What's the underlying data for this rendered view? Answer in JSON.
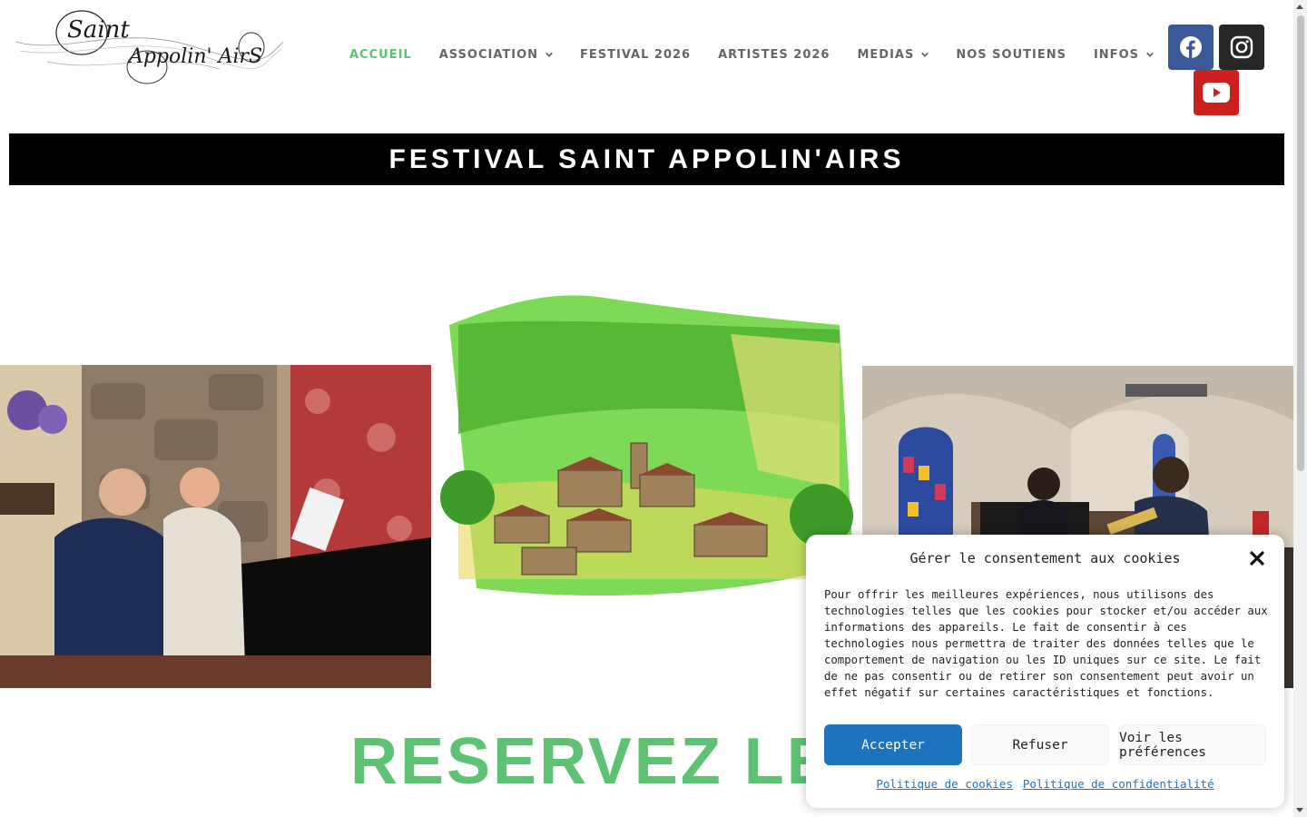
{
  "logo": {
    "line1": "Saint",
    "line2": "Appolin' AirS"
  },
  "nav": {
    "items": [
      {
        "label": "ACCUEIL",
        "active": true,
        "dropdown": false
      },
      {
        "label": "ASSOCIATION",
        "active": false,
        "dropdown": true
      },
      {
        "label": "FESTIVAL 2026",
        "active": false,
        "dropdown": false
      },
      {
        "label": "ARTISTES 2026",
        "active": false,
        "dropdown": false
      },
      {
        "label": "MEDIAS",
        "active": false,
        "dropdown": true
      },
      {
        "label": "NOS SOUTIENS",
        "active": false,
        "dropdown": false
      },
      {
        "label": "INFOS",
        "active": false,
        "dropdown": true
      }
    ]
  },
  "social": [
    {
      "name": "facebook-icon",
      "color": "#3b5998"
    },
    {
      "name": "instagram-icon",
      "color": "#262626"
    },
    {
      "name": "youtube-icon",
      "color": "#cd201f"
    }
  ],
  "banner": {
    "title": "FESTIVAL SAINT APPOLIN'AIRS"
  },
  "main": {
    "reserve_heading": "RESERVEZ LES 1"
  },
  "cookie_dialog": {
    "title": "Gérer le consentement aux cookies",
    "body": "Pour offrir les meilleures expériences, nous utilisons des technologies telles que les cookies pour stocker et/ou accéder aux informations des appareils. Le fait de consentir à ces technologies nous permettra de traiter des données telles que le comportement de navigation ou les ID uniques sur ce site. Le fait de ne pas consentir ou de retirer son consentement peut avoir un effet négatif sur certaines caractéristiques et fonctions.",
    "accept_label": "Accepter",
    "refuse_label": "Refuser",
    "prefs_label": "Voir les préférences",
    "cookie_policy_label": "Politique de cookies",
    "privacy_policy_label": "Politique de confidentialité"
  },
  "colors": {
    "accent": "#5ec273",
    "primary_button": "#1e73be",
    "banner": "#000000"
  }
}
